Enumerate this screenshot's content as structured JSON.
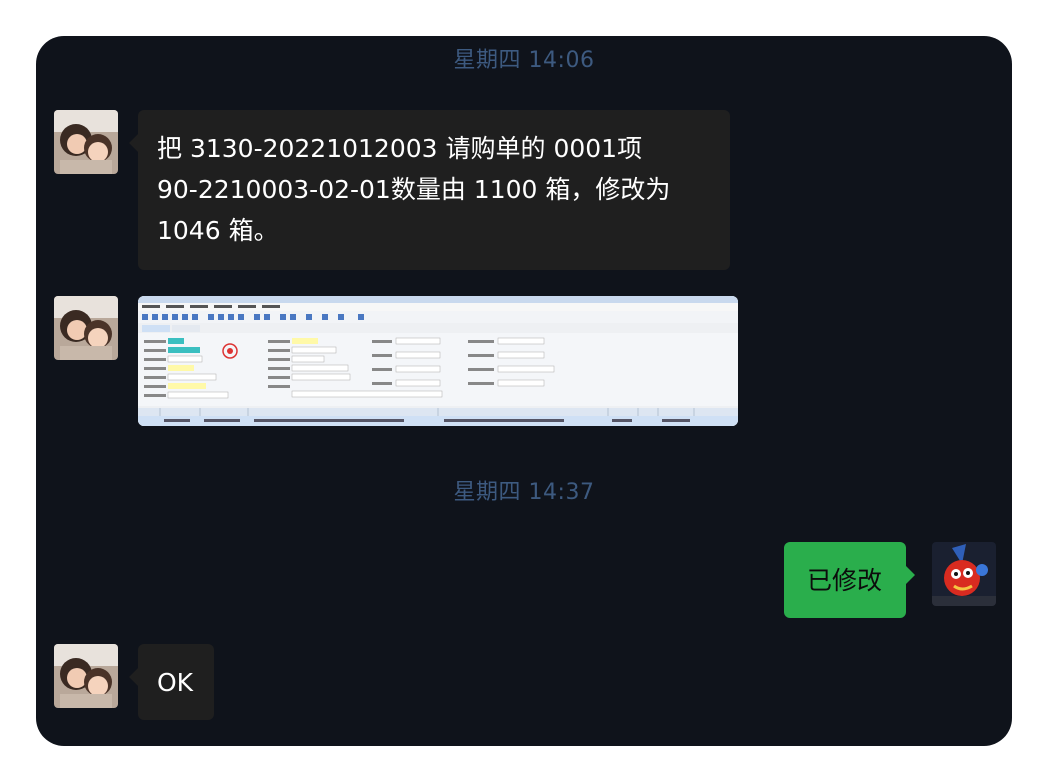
{
  "chat": {
    "timestamps": [
      "星期四 14:06",
      "星期四 14:37"
    ],
    "messages": [
      {
        "sender": "other",
        "lines": [
          "把 3130-20221012003 请购单的 0001项",
          "90-2210003-02-01数量由 1100 箱，修改为",
          "1046 箱。"
        ]
      },
      {
        "sender": "other",
        "kind": "image",
        "content": "erp-form-screenshot"
      },
      {
        "sender": "me",
        "text": "已修改"
      },
      {
        "sender": "other",
        "text": "OK"
      }
    ]
  },
  "colors": {
    "window_bg": "#0f131b",
    "other_bubble": "#1f1f1f",
    "my_bubble": "#2aae4c",
    "timestamp": "#3d5a80"
  },
  "icons": {
    "other_avatar": "avatar-photo-icon",
    "my_avatar": "avatar-cartoon-icon"
  }
}
